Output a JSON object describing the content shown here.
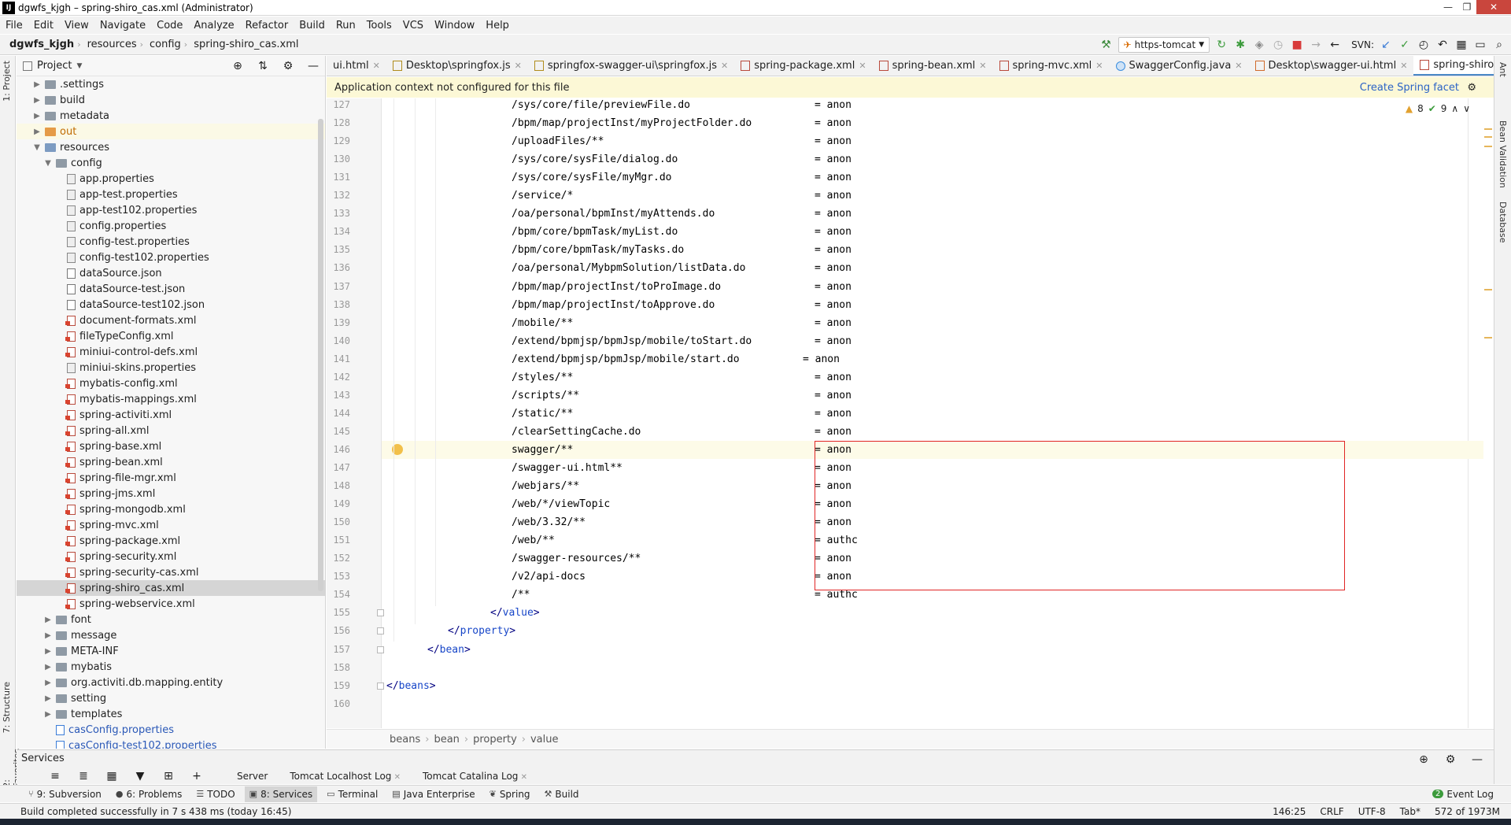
{
  "window": {
    "title": "dgwfs_kjgh – spring-shiro_cas.xml (Administrator)",
    "app_icon": "IJ",
    "minimize": "—",
    "maximize": "❐",
    "close": "✕"
  },
  "menu": [
    "File",
    "Edit",
    "View",
    "Navigate",
    "Code",
    "Analyze",
    "Refactor",
    "Build",
    "Run",
    "Tools",
    "VCS",
    "Window",
    "Help"
  ],
  "breadcrumb": [
    "dgwfs_kjgh",
    "resources",
    "config",
    "spring-shiro_cas.xml"
  ],
  "toolbar": {
    "run_config": "https-tomcat",
    "svn_label": "SVN:"
  },
  "left_strip": {
    "project_tab": "1: Project",
    "structure_tab": "7: Structure",
    "favorites_tab": "2: Favorites"
  },
  "right_strip": {
    "ant_tab": "Ant",
    "bean_validation_tab": "Bean Validation",
    "database_tab": "Database"
  },
  "project": {
    "title": "Project",
    "items": [
      {
        "label": ".settings",
        "indent": 1,
        "type": "folder",
        "arrow": "▶"
      },
      {
        "label": "build",
        "indent": 1,
        "type": "folder",
        "arrow": "▶"
      },
      {
        "label": "metadata",
        "indent": 1,
        "type": "folder",
        "arrow": "▶"
      },
      {
        "label": "out",
        "indent": 1,
        "type": "folder-out",
        "arrow": "▶"
      },
      {
        "label": "resources",
        "indent": 1,
        "type": "folder-res",
        "arrow": "▼"
      },
      {
        "label": "config",
        "indent": 2,
        "type": "folder",
        "arrow": "▼"
      },
      {
        "label": "app.properties",
        "indent": 3,
        "type": "props"
      },
      {
        "label": "app-test.properties",
        "indent": 3,
        "type": "props"
      },
      {
        "label": "app-test102.properties",
        "indent": 3,
        "type": "props"
      },
      {
        "label": "config.properties",
        "indent": 3,
        "type": "props"
      },
      {
        "label": "config-test.properties",
        "indent": 3,
        "type": "props"
      },
      {
        "label": "config-test102.properties",
        "indent": 3,
        "type": "props"
      },
      {
        "label": "dataSource.json",
        "indent": 3,
        "type": "json"
      },
      {
        "label": "dataSource-test.json",
        "indent": 3,
        "type": "json"
      },
      {
        "label": "dataSource-test102.json",
        "indent": 3,
        "type": "json"
      },
      {
        "label": "document-formats.xml",
        "indent": 3,
        "type": "xml"
      },
      {
        "label": "fileTypeConfig.xml",
        "indent": 3,
        "type": "xml"
      },
      {
        "label": "miniui-control-defs.xml",
        "indent": 3,
        "type": "xml"
      },
      {
        "label": "miniui-skins.properties",
        "indent": 3,
        "type": "props"
      },
      {
        "label": "mybatis-config.xml",
        "indent": 3,
        "type": "xml"
      },
      {
        "label": "mybatis-mappings.xml",
        "indent": 3,
        "type": "xml"
      },
      {
        "label": "spring-activiti.xml",
        "indent": 3,
        "type": "xml"
      },
      {
        "label": "spring-all.xml",
        "indent": 3,
        "type": "xml"
      },
      {
        "label": "spring-base.xml",
        "indent": 3,
        "type": "xml"
      },
      {
        "label": "spring-bean.xml",
        "indent": 3,
        "type": "xml"
      },
      {
        "label": "spring-file-mgr.xml",
        "indent": 3,
        "type": "xml"
      },
      {
        "label": "spring-jms.xml",
        "indent": 3,
        "type": "xml"
      },
      {
        "label": "spring-mongodb.xml",
        "indent": 3,
        "type": "xml"
      },
      {
        "label": "spring-mvc.xml",
        "indent": 3,
        "type": "xml"
      },
      {
        "label": "spring-package.xml",
        "indent": 3,
        "type": "xml"
      },
      {
        "label": "spring-security.xml",
        "indent": 3,
        "type": "xml"
      },
      {
        "label": "spring-security-cas.xml",
        "indent": 3,
        "type": "xml"
      },
      {
        "label": "spring-shiro_cas.xml",
        "indent": 3,
        "type": "xml",
        "selected": true
      },
      {
        "label": "spring-webservice.xml",
        "indent": 3,
        "type": "xml"
      },
      {
        "label": "font",
        "indent": 2,
        "type": "folder",
        "arrow": "▶"
      },
      {
        "label": "message",
        "indent": 2,
        "type": "folder",
        "arrow": "▶"
      },
      {
        "label": "META-INF",
        "indent": 2,
        "type": "folder",
        "arrow": "▶"
      },
      {
        "label": "mybatis",
        "indent": 2,
        "type": "folder",
        "arrow": "▶"
      },
      {
        "label": "org.activiti.db.mapping.entity",
        "indent": 2,
        "type": "folder",
        "arrow": "▶"
      },
      {
        "label": "setting",
        "indent": 2,
        "type": "folder",
        "arrow": "▶"
      },
      {
        "label": "templates",
        "indent": 2,
        "type": "folder",
        "arrow": "▶"
      },
      {
        "label": "casConfig.properties",
        "indent": 2,
        "type": "cas"
      },
      {
        "label": "casConfig-test102.properties",
        "indent": 2,
        "type": "cas"
      }
    ]
  },
  "tabs": [
    {
      "label": "ui.html",
      "icon": "html"
    },
    {
      "label": "Desktop\\springfox.js",
      "icon": "js"
    },
    {
      "label": "springfox-swagger-ui\\springfox.js",
      "icon": "js"
    },
    {
      "label": "spring-package.xml",
      "icon": "xml"
    },
    {
      "label": "spring-bean.xml",
      "icon": "xml"
    },
    {
      "label": "spring-mvc.xml",
      "icon": "xml"
    },
    {
      "label": "SwaggerConfig.java",
      "icon": "java"
    },
    {
      "label": "Desktop\\swagger-ui.html",
      "icon": "html"
    },
    {
      "label": "spring-shiro_cas.xml",
      "icon": "xml",
      "active": true
    }
  ],
  "banner": {
    "message": "Application context not configured for this file",
    "action": "Create Spring facet"
  },
  "inspection": {
    "warnings": "8",
    "ok": "9"
  },
  "code": {
    "lines": [
      {
        "n": "127",
        "path": "/sys/core/file/previewFile.do",
        "val": "anon"
      },
      {
        "n": "128",
        "path": "/bpm/map/projectInst/myProjectFolder.do",
        "val": "anon"
      },
      {
        "n": "129",
        "path": "/uploadFiles/**",
        "val": "anon"
      },
      {
        "n": "130",
        "path": "/sys/core/sysFile/dialog.do",
        "val": "anon"
      },
      {
        "n": "131",
        "path": "/sys/core/sysFile/myMgr.do",
        "val": "anon"
      },
      {
        "n": "132",
        "path": "/service/*",
        "val": "anon"
      },
      {
        "n": "133",
        "path": "/oa/personal/bpmInst/myAttends.do",
        "val": "anon"
      },
      {
        "n": "134",
        "path": "/bpm/core/bpmTask/myList.do",
        "val": "anon"
      },
      {
        "n": "135",
        "path": "/bpm/core/bpmTask/myTasks.do",
        "val": "anon"
      },
      {
        "n": "136",
        "path": "/oa/personal/MybpmSolution/listData.do",
        "val": "anon"
      },
      {
        "n": "137",
        "path": "/bpm/map/projectInst/toProImage.do",
        "val": "anon"
      },
      {
        "n": "138",
        "path": "/bpm/map/projectInst/toApprove.do",
        "val": "anon"
      },
      {
        "n": "139",
        "path": "/mobile/**",
        "val": "anon"
      },
      {
        "n": "140",
        "path": "/extend/bpmjsp/bpmJsp/mobile/toStart.do",
        "val": "anon"
      },
      {
        "n": "141",
        "path": "/extend/bpmjsp/bpmJsp/mobile/start.do",
        "val": "anon",
        "shift": true
      },
      {
        "n": "142",
        "path": "/styles/**",
        "val": "anon"
      },
      {
        "n": "143",
        "path": "/scripts/**",
        "val": "anon"
      },
      {
        "n": "144",
        "path": "/static/**",
        "val": "anon"
      },
      {
        "n": "145",
        "path": "/clearSettingCache.do",
        "val": "anon"
      },
      {
        "n": "146",
        "path": "swagger/**",
        "val": "anon",
        "caret": true
      },
      {
        "n": "147",
        "path": "/swagger-ui.html**",
        "val": "anon"
      },
      {
        "n": "148",
        "path": "/webjars/**",
        "val": "anon"
      },
      {
        "n": "149",
        "path": "/web/*/viewTopic",
        "val": "anon"
      },
      {
        "n": "150",
        "path": "/web/3.32/**",
        "val": "anon"
      },
      {
        "n": "151",
        "path": "/web/**",
        "val": "authc"
      },
      {
        "n": "152",
        "path": "/swagger-resources/**",
        "val": "anon"
      },
      {
        "n": "153",
        "path": "/v2/api-docs",
        "val": "anon"
      },
      {
        "n": "154",
        "path": "/**",
        "val": "authc"
      }
    ],
    "closing": [
      {
        "n": "155",
        "text": "</value>",
        "indent": 9,
        "tag": "value"
      },
      {
        "n": "156",
        "text": "</property>",
        "indent": 6,
        "tag": "property"
      },
      {
        "n": "157",
        "text": "</bean>",
        "indent": 4,
        "tag": "bean"
      },
      {
        "n": "158",
        "text": "",
        "indent": 0
      },
      {
        "n": "159",
        "text": "</beans>",
        "indent": 0,
        "tag": "beans"
      },
      {
        "n": "160",
        "text": "",
        "indent": 0
      }
    ]
  },
  "editor_breadcrumb": [
    "beans",
    "bean",
    "property",
    "value"
  ],
  "services": {
    "title": "Services",
    "tabs": [
      "Server",
      "Tomcat Localhost Log",
      "Tomcat Catalina Log"
    ]
  },
  "tool_windows": [
    {
      "label": "9: Subversion",
      "icon": "⑂"
    },
    {
      "label": "6: Problems",
      "icon": "●"
    },
    {
      "label": "TODO",
      "icon": "☰"
    },
    {
      "label": "8: Services",
      "icon": "▣",
      "active": true
    },
    {
      "label": "Terminal",
      "icon": "▭"
    },
    {
      "label": "Java Enterprise",
      "icon": "▤"
    },
    {
      "label": "Spring",
      "icon": "❦"
    },
    {
      "label": "Build",
      "icon": "⚒"
    }
  ],
  "event_log": "Event Log",
  "event_log_count": "2",
  "status": {
    "message": "Build completed successfully in 7 s 438 ms (today 16:45)",
    "position": "146:25",
    "line_sep": "CRLF",
    "encoding": "UTF-8",
    "indent": "Tab*",
    "memory": "572 of 1973M"
  }
}
